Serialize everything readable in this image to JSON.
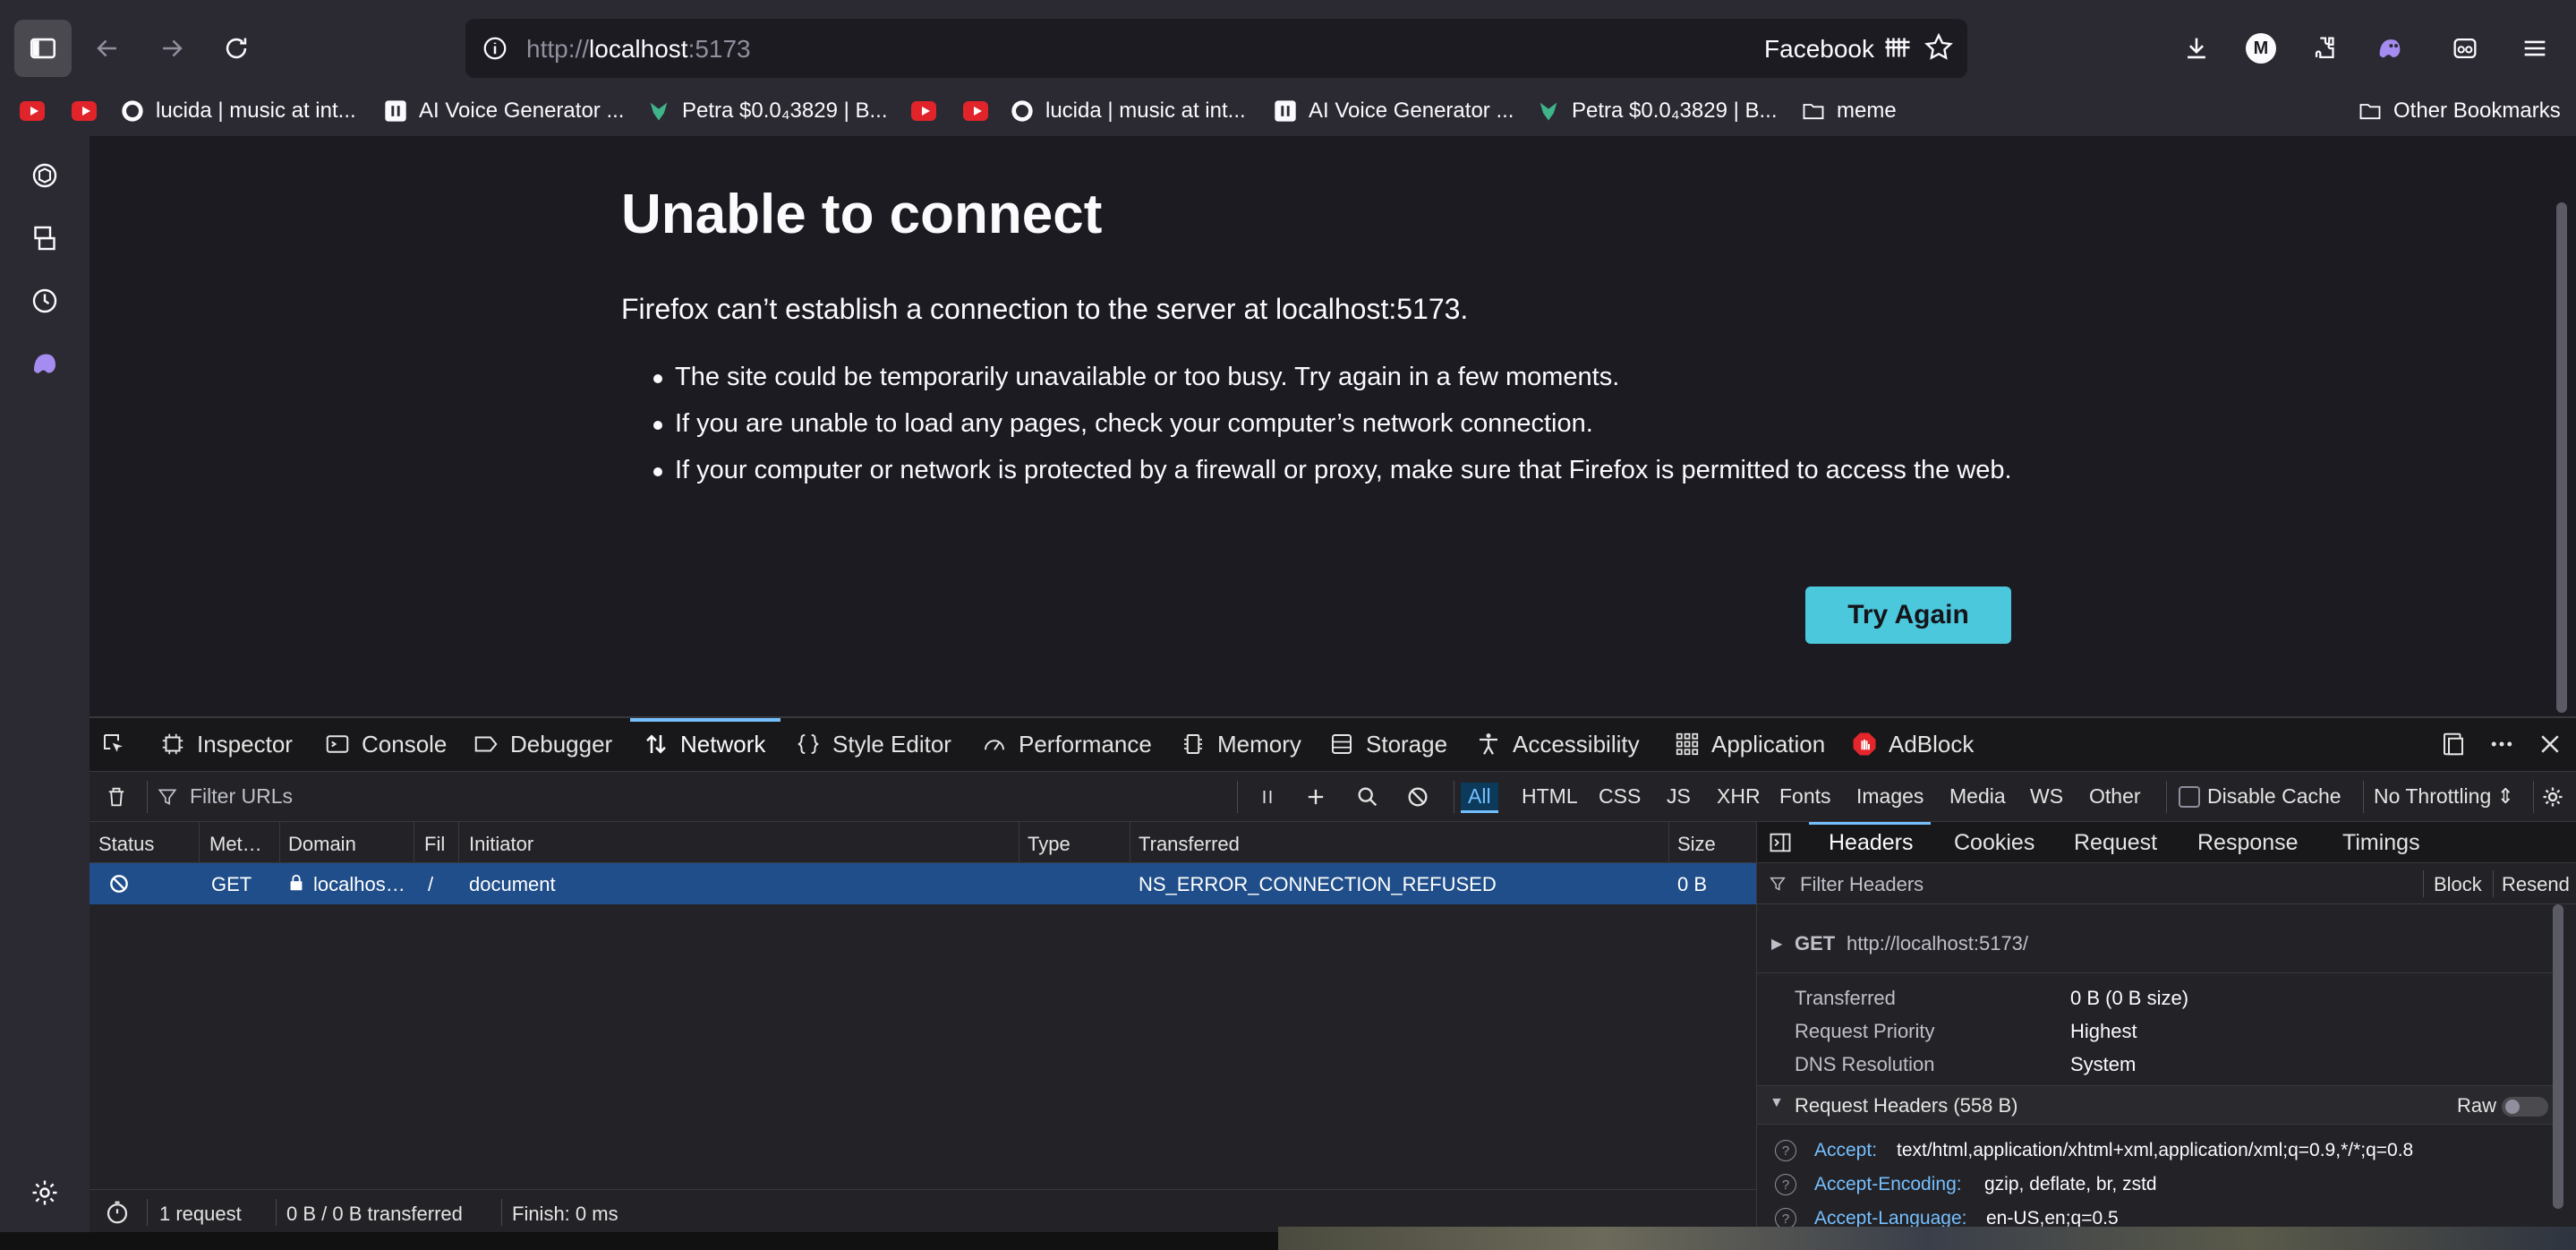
{
  "browser": {
    "url_prefix": "http://",
    "url_host": "localhost",
    "url_suffix": ":5173",
    "site_name": "Facebook",
    "profile_initial": "M"
  },
  "bookmarks": [
    {
      "label": "",
      "icon": "youtube-icon"
    },
    {
      "label": "",
      "icon": "youtube-icon"
    },
    {
      "label": "lucida | music at int...",
      "icon": "lucida-icon"
    },
    {
      "label": "AI Voice Generator ...",
      "icon": "pause-icon"
    },
    {
      "label": "Petra $0.0₄3829 | B...",
      "icon": "petra-icon"
    },
    {
      "label": "",
      "icon": "youtube-icon"
    },
    {
      "label": "",
      "icon": "youtube-icon"
    },
    {
      "label": "lucida | music at int...",
      "icon": "lucida-icon"
    },
    {
      "label": "AI Voice Generator ...",
      "icon": "pause-icon"
    },
    {
      "label": "Petra $0.0₄3829 | B...",
      "icon": "petra-icon"
    },
    {
      "label": "meme",
      "icon": "folder-icon"
    },
    {
      "label": "Other Bookmarks",
      "icon": "folder-icon"
    }
  ],
  "error_page": {
    "title": "Unable to connect",
    "description": "Firefox can’t establish a connection to the server at localhost:5173.",
    "bullets": [
      "The site could be temporarily unavailable or too busy. Try again in a few moments.",
      "If you are unable to load any pages, check your computer’s network connection.",
      "If your computer or network is protected by a firewall or proxy, make sure that Firefox is permitted to access the web."
    ],
    "button": "Try Again"
  },
  "devtools": {
    "tabs": [
      "Inspector",
      "Console",
      "Debugger",
      "Network",
      "Style Editor",
      "Performance",
      "Memory",
      "Storage",
      "Accessibility",
      "Application",
      "AdBlock"
    ],
    "active_tab": "Network",
    "filter_placeholder": "Filter URLs",
    "type_filters": [
      "All",
      "HTML",
      "CSS",
      "JS",
      "XHR",
      "Fonts",
      "Images",
      "Media",
      "WS",
      "Other"
    ],
    "disable_cache": "Disable Cache",
    "throttling": "No Throttling",
    "columns": [
      "Status",
      "Met…",
      "Domain",
      "Fil",
      "Initiator",
      "Type",
      "Transferred",
      "Size"
    ],
    "request": {
      "method": "GET",
      "domain": "localhos…",
      "file": "/",
      "initiator": "document",
      "type": "",
      "transferred": "NS_ERROR_CONNECTION_REFUSED",
      "size": "0 B"
    },
    "status": {
      "requests": "1 request",
      "transferred": "0 B / 0 B transferred",
      "finish": "Finish: 0 ms"
    },
    "details": {
      "tabs": [
        "Headers",
        "Cookies",
        "Request",
        "Response",
        "Timings"
      ],
      "filter_placeholder": "Filter Headers",
      "block": "Block",
      "resend": "Resend",
      "summary_method": "GET",
      "summary_url": "http://localhost:5173/",
      "fields": [
        {
          "label": "Transferred",
          "value": "0 B (0 B size)"
        },
        {
          "label": "Request Priority",
          "value": "Highest"
        },
        {
          "label": "DNS Resolution",
          "value": "System"
        }
      ],
      "request_headers_title": "Request Headers (558 B)",
      "raw_label": "Raw",
      "headers": [
        {
          "name": "Accept:",
          "value": "text/html,application/xhtml+xml,application/xml;q=0.9,*/*;q=0.8"
        },
        {
          "name": "Accept-Encoding:",
          "value": "gzip, deflate, br, zstd"
        },
        {
          "name": "Accept-Language:",
          "value": "en-US,en;q=0.5"
        }
      ]
    }
  }
}
